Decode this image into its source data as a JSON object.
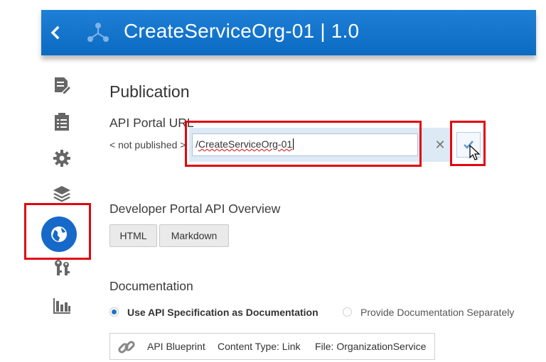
{
  "header": {
    "title": "CreateServiceOrg-01 | 1.0",
    "back_icon": "chevron-left-icon",
    "logo_icon": "service-nodes-icon",
    "color": "#0f72cc"
  },
  "sidebar": {
    "items": [
      {
        "icon": "document-edit-icon"
      },
      {
        "icon": "checklist-icon"
      },
      {
        "icon": "gear-icon"
      },
      {
        "icon": "layers-icon"
      },
      {
        "icon": "globe-icon",
        "active": true
      },
      {
        "icon": "keys-icon"
      },
      {
        "icon": "bar-chart-icon"
      }
    ],
    "active_color": "#1669c9"
  },
  "main": {
    "title": "Publication",
    "api_portal": {
      "label": "API Portal URL",
      "prefix": "< not published >",
      "value_prefix": "/",
      "value": "CreateServiceOrg-01",
      "clear_symbol": "✕"
    },
    "developer_portal": {
      "label": "Developer Portal API Overview",
      "buttons": [
        "HTML",
        "Markdown"
      ]
    },
    "documentation": {
      "label": "Documentation",
      "options": [
        {
          "label": "Use API Specification as Documentation",
          "selected": true
        },
        {
          "label": "Provide Documentation Separately",
          "selected": false
        }
      ],
      "blueprint": {
        "icon": "link-icon",
        "name": "API Blueprint",
        "content_type": "Content Type: Link",
        "file": "File: OrganizationService"
      }
    }
  },
  "highlight_color": "#e0080f"
}
